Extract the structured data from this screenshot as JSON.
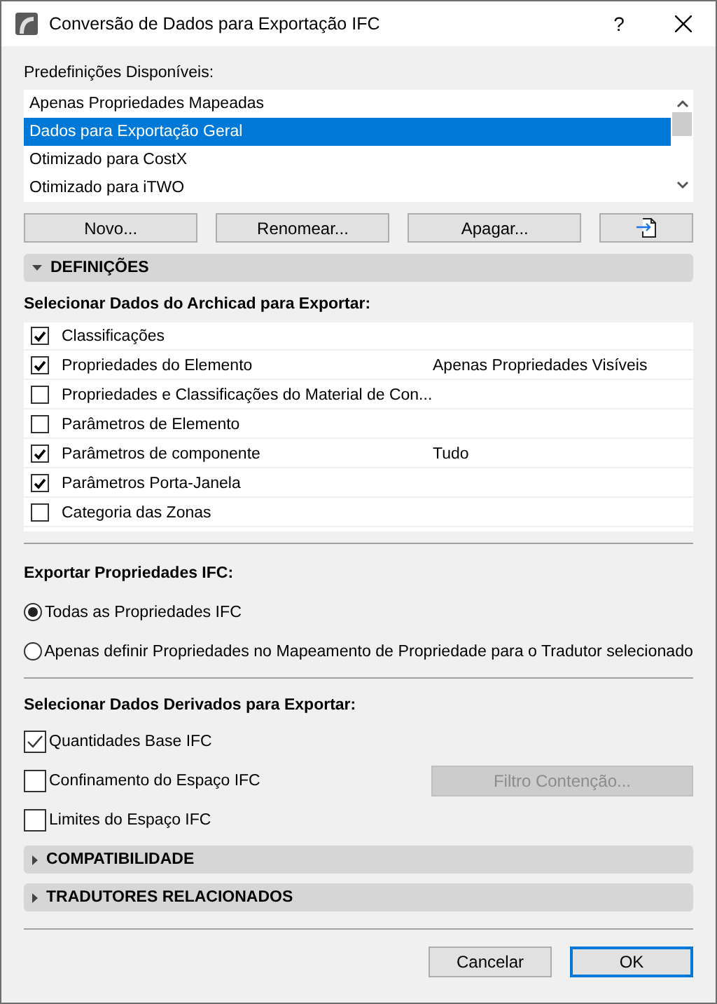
{
  "window": {
    "title": "Conversão de Dados para Exportação IFC",
    "help": "?"
  },
  "presets": {
    "label": "Predefinições Disponíveis:",
    "items": [
      {
        "label": "Apenas Propriedades Mapeadas",
        "selected": false
      },
      {
        "label": "Dados para Exportação Geral",
        "selected": true
      },
      {
        "label": "Otimizado para CostX",
        "selected": false
      },
      {
        "label": "Otimizado para iTWO",
        "selected": false
      }
    ]
  },
  "preset_buttons": [
    "Novo...",
    "Renomear...",
    "Apagar..."
  ],
  "settings_section": {
    "title": "DEFINIÇÕES",
    "expanded": true
  },
  "archicad_data": {
    "label": "Selecionar Dados do Archicad para Exportar:",
    "rows": [
      {
        "label": "Classificações",
        "checked": true
      },
      {
        "label": "Propriedades do Elemento",
        "checked": true,
        "value": "Apenas Propriedades Visíveis"
      },
      {
        "label": "Propriedades e Classificações do Material de Con...",
        "checked": false
      },
      {
        "label": "Parâmetros de Elemento",
        "checked": false
      },
      {
        "label": "Parâmetros de componente",
        "checked": true,
        "value": "Tudo"
      },
      {
        "label": "Parâmetros Porta-Janela",
        "checked": true
      },
      {
        "label": "Categoria das Zonas",
        "checked": false
      }
    ]
  },
  "ifc_properties": {
    "label": "Exportar Propriedades IFC:",
    "options": [
      {
        "label": "Todas as Propriedades IFC",
        "selected": true
      },
      {
        "label": "Apenas definir Propriedades no Mapeamento de Propriedade para o Tradutor selecionado",
        "selected": false
      }
    ]
  },
  "derived_data": {
    "label": "Selecionar Dados Derivados para Exportar:",
    "items": [
      {
        "label": "Quantidades Base IFC",
        "checked": true
      },
      {
        "label": "Confinamento do Espaço IFC",
        "checked": false,
        "button": {
          "label": "Filtro Contenção...",
          "disabled": true
        }
      },
      {
        "label": "Limites do Espaço IFC",
        "checked": false
      }
    ]
  },
  "collapsed_sections": [
    {
      "title": "COMPATIBILIDADE",
      "expanded": false
    },
    {
      "title": "TRADUTORES RELACIONADOS",
      "expanded": false
    }
  ],
  "footer_buttons": [
    {
      "label": "Cancelar",
      "default": false
    },
    {
      "label": "OK",
      "default": true
    }
  ]
}
